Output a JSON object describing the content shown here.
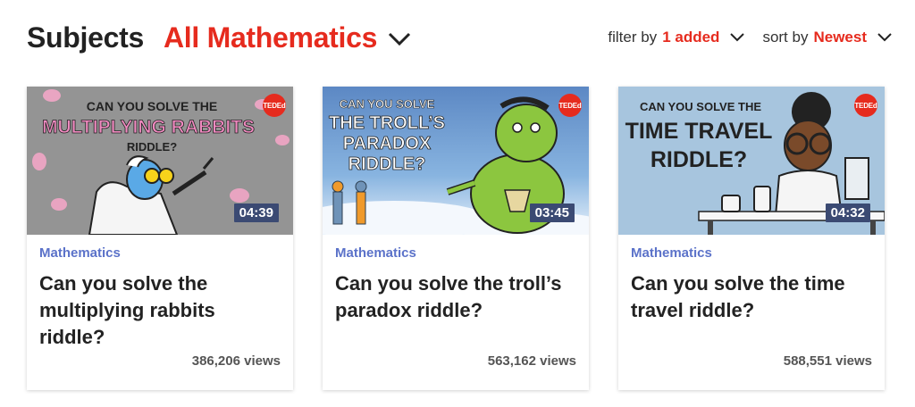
{
  "header": {
    "subjects_label": "Subjects",
    "subject_value": "All Mathematics",
    "filter_label": "filter by",
    "filter_value": "1 added",
    "sort_label": "sort by",
    "sort_value": "Newest"
  },
  "colors": {
    "accent": "#e62b1e",
    "category": "#5b72c9",
    "duration_bg": "#3b4a73"
  },
  "cards": [
    {
      "category": "Mathematics",
      "title": "Can you solve the multiplying rabbits riddle?",
      "views": "386,206 views",
      "duration": "04:39",
      "thumb_text": [
        "CAN YOU SOLVE THE",
        "MULTIPLYING RABBITS",
        "RIDDLE?"
      ],
      "badge": "TEDEd"
    },
    {
      "category": "Mathematics",
      "title": "Can you solve the troll’s paradox riddle?",
      "views": "563,162 views",
      "duration": "03:45",
      "thumb_text": [
        "CAN YOU SOLVE",
        "THE TROLL’S",
        "PARADOX",
        "RIDDLE?"
      ],
      "badge": "TEDEd"
    },
    {
      "category": "Mathematics",
      "title": "Can you solve the time travel riddle?",
      "views": "588,551 views",
      "duration": "04:32",
      "thumb_text": [
        "CAN YOU SOLVE THE",
        "TIME TRAVEL",
        "RIDDLE?"
      ],
      "badge": "TEDEd"
    }
  ]
}
